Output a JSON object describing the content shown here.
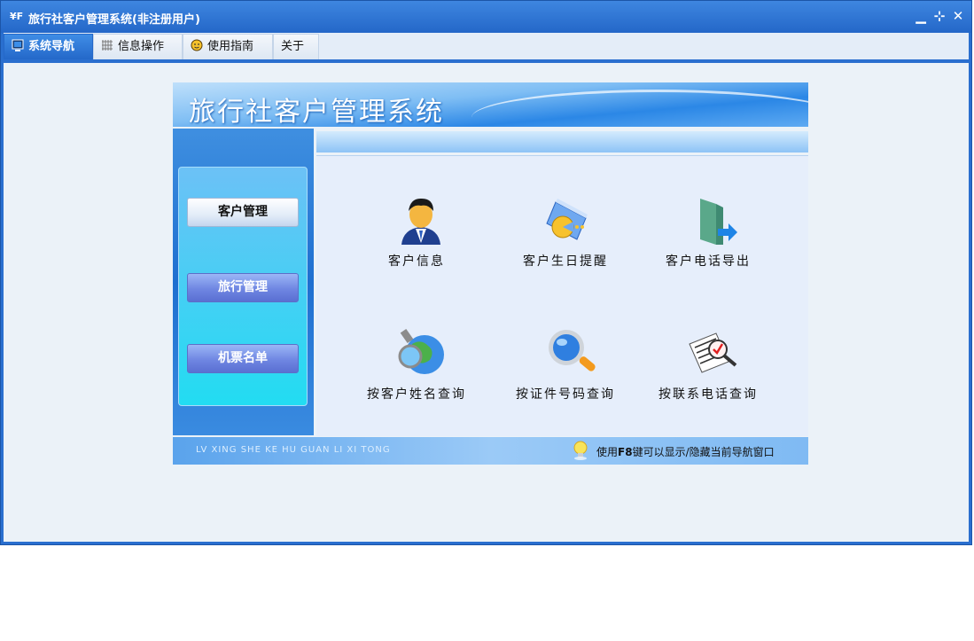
{
  "window": {
    "title": "旅行社客户管理系统(非注册用户)",
    "app_icon_text": "¥F",
    "controls": {
      "minimize": "▁",
      "restore": "⊹",
      "close": "✕"
    }
  },
  "menu": {
    "tabs": [
      {
        "label": "系统导航",
        "icon": "monitor-icon",
        "active": true
      },
      {
        "label": "信息操作",
        "icon": "grid-icon",
        "active": false
      },
      {
        "label": "使用指南",
        "icon": "face-icon",
        "active": false
      },
      {
        "label": "关于",
        "icon": "",
        "active": false
      }
    ]
  },
  "nav_panel": {
    "title": "旅行社客户管理系统",
    "side_buttons": [
      {
        "label": "客户管理",
        "active": true
      },
      {
        "label": "旅行管理",
        "active": false
      },
      {
        "label": "机票名单",
        "active": false
      }
    ],
    "items": [
      {
        "label": "客户信息",
        "icon": "user-icon"
      },
      {
        "label": "客户生日提醒",
        "icon": "birthday-folder-icon"
      },
      {
        "label": "客户电话导出",
        "icon": "export-folder-icon"
      },
      {
        "label": "按客户姓名查询",
        "icon": "globe-search-icon"
      },
      {
        "label": "按证件号码查询",
        "icon": "magnifier-icon"
      },
      {
        "label": "按联系电话查询",
        "icon": "document-search-icon"
      }
    ],
    "footer": {
      "pinyin": "LV XING SHE KE HU GUAN LI XI TONG",
      "tip_prefix": "使用",
      "tip_key": "F8",
      "tip_suffix": "键可以显示/隐藏当前导航窗口"
    }
  },
  "colors": {
    "title_bar": "#2a6fcf",
    "active_tab": "#2468c9",
    "side_panel": "#22dcf2",
    "main_panel": "#e6eefb"
  }
}
